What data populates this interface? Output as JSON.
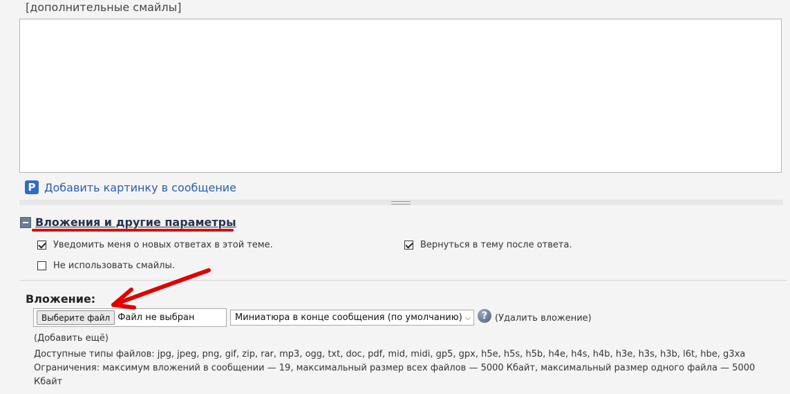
{
  "smilies_link": "[дополнительные смайлы]",
  "add_picture": {
    "icon": "P",
    "label": "Добавить картинку в сообщение"
  },
  "section": {
    "title": "Вложения и другие параметры",
    "accent_color": "#e00000"
  },
  "options": {
    "notify": {
      "label": "Уведомить меня о новых ответах в этой теме.",
      "checked": true
    },
    "return": {
      "label": "Вернуться в тему после ответа.",
      "checked": true
    },
    "no_smilies": {
      "label": "Не использовать смайлы.",
      "checked": false
    }
  },
  "attachment": {
    "label": "Вложение:",
    "choose_button": "Выберите файл",
    "file_status": "Файл не выбран",
    "thumbnail_select": "Миниатюра в конце сообщения (по умолчанию)",
    "help_icon": "?",
    "remove_link": "(Удалить вложение)",
    "add_more": "(Добавить ещё)",
    "allowed_types": "Доступные типы файлов: jpg, jpeg, png, gif, zip, rar, mp3, ogg, txt, doc, pdf, mid, midi, gp5, gpx, h5e, h5s, h5b, h4e, h4s, h4b, h3e, h3s, h3b, l6t, hbe, g3xa",
    "limits_line1": "Ограничения: максимум вложений в сообщении — 19, максимальный размер всех файлов — 5000 Кбайт, максимальный размер одного файла — 5000",
    "limits_line2": "Кбайт"
  }
}
